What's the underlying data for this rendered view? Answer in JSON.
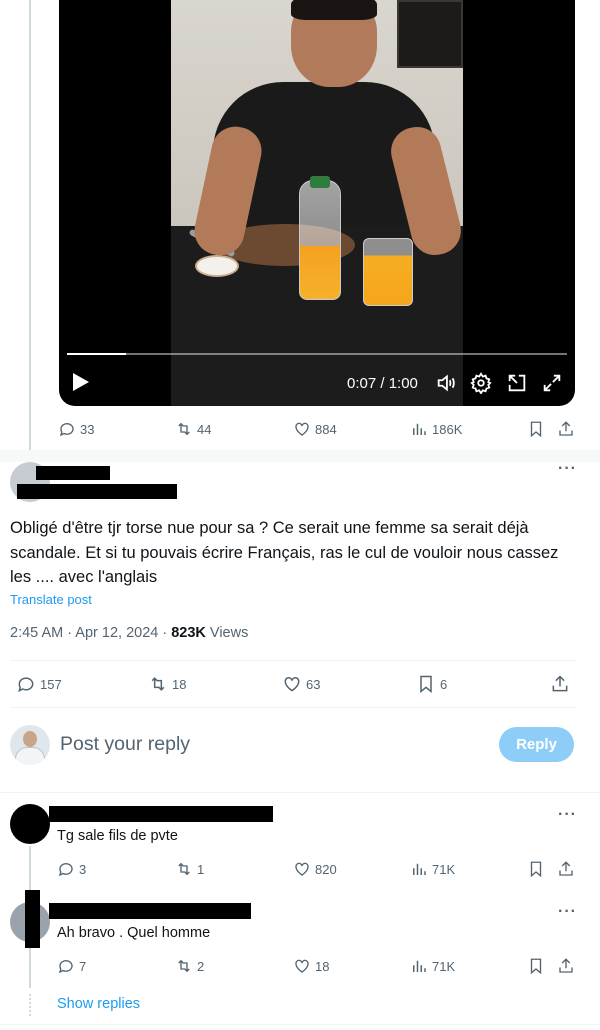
{
  "video": {
    "time": "0:07 / 1:00",
    "progress_fraction": 0.117,
    "icons": [
      "play-icon",
      "volume-icon",
      "settings-icon",
      "pip-icon",
      "fullscreen-icon"
    ]
  },
  "parent_actions": {
    "replies": "33",
    "reposts": "44",
    "likes": "884",
    "views": "186K"
  },
  "main_post": {
    "text": "Obligé d'être tjr torse nue pour sa ? Ce serait une femme sa serait déjà scandale. Et si tu pouvais écrire Français, ras le cul de vouloir nous cassez les .... avec l'anglais",
    "translate_label": "Translate post",
    "time": "2:45 AM · Apr 12, 2024 · ",
    "views_count": "823K",
    "views_label": " Views",
    "replies": "157",
    "reposts": "18",
    "likes": "63",
    "bookmarks": "6"
  },
  "composer": {
    "placeholder": "Post your reply",
    "button_label": "Reply"
  },
  "replies": [
    {
      "text": "Tg sale fils de pvte",
      "replies": "3",
      "reposts": "1",
      "likes": "820",
      "views": "71K"
    },
    {
      "text": "Ah bravo . Quel homme",
      "replies": "7",
      "reposts": "2",
      "likes": "18",
      "views": "71K"
    }
  ],
  "show_replies_label": "Show replies",
  "colors": {
    "accent": "#1d9bf0",
    "muted": "#536471",
    "reply_button_disabled": "#8ecdf8"
  }
}
